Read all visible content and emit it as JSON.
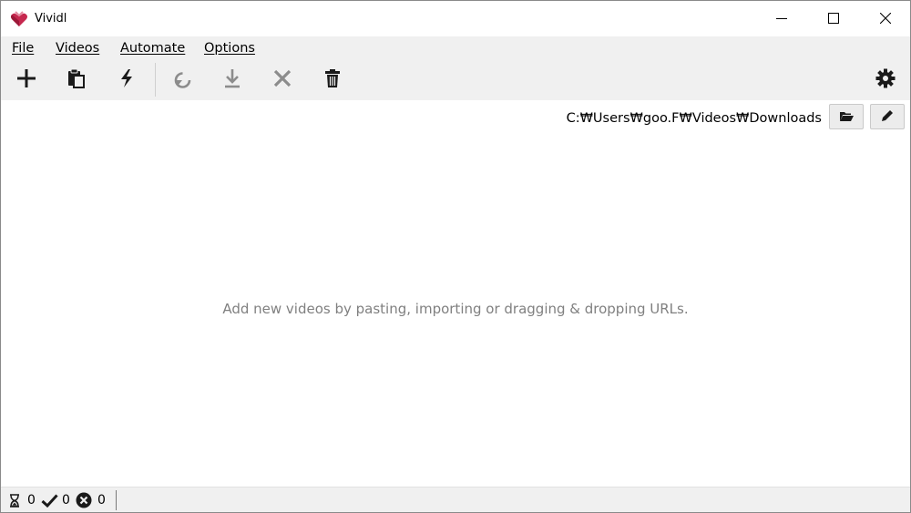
{
  "window": {
    "title": "Vividl",
    "controls": [
      "minimize-icon",
      "maximize-icon",
      "close-icon"
    ]
  },
  "menu": {
    "items": [
      {
        "label": "File"
      },
      {
        "label": "Videos"
      },
      {
        "label": "Automate"
      },
      {
        "label": "Options"
      }
    ]
  },
  "toolbar": {
    "buttons": [
      {
        "icon": "plus-icon",
        "enabled": true
      },
      {
        "icon": "paste-icon",
        "enabled": true
      },
      {
        "icon": "lightning-icon",
        "enabled": true
      },
      {
        "icon": "retry-icon",
        "enabled": false
      },
      {
        "icon": "download-icon",
        "enabled": false
      },
      {
        "icon": "cancel-icon",
        "enabled": false
      },
      {
        "icon": "trash-icon",
        "enabled": true
      }
    ],
    "settings_icon": "gear-icon"
  },
  "download_path": {
    "value": "C:₩Users₩goo.F₩Videos₩Downloads",
    "open_folder_icon": "folder-open-icon",
    "edit_icon": "pencil-icon"
  },
  "main": {
    "empty_message": "Add new videos by pasting, importing or dragging & dropping URLs."
  },
  "status": {
    "pending_count": "0",
    "completed_count": "0",
    "failed_count": "0"
  },
  "colors": {
    "enabled_icon": "#1a1a1a",
    "disabled_icon": "#8c8c8c",
    "bar_background": "#f0f0f0",
    "logo": "#c2185b"
  }
}
